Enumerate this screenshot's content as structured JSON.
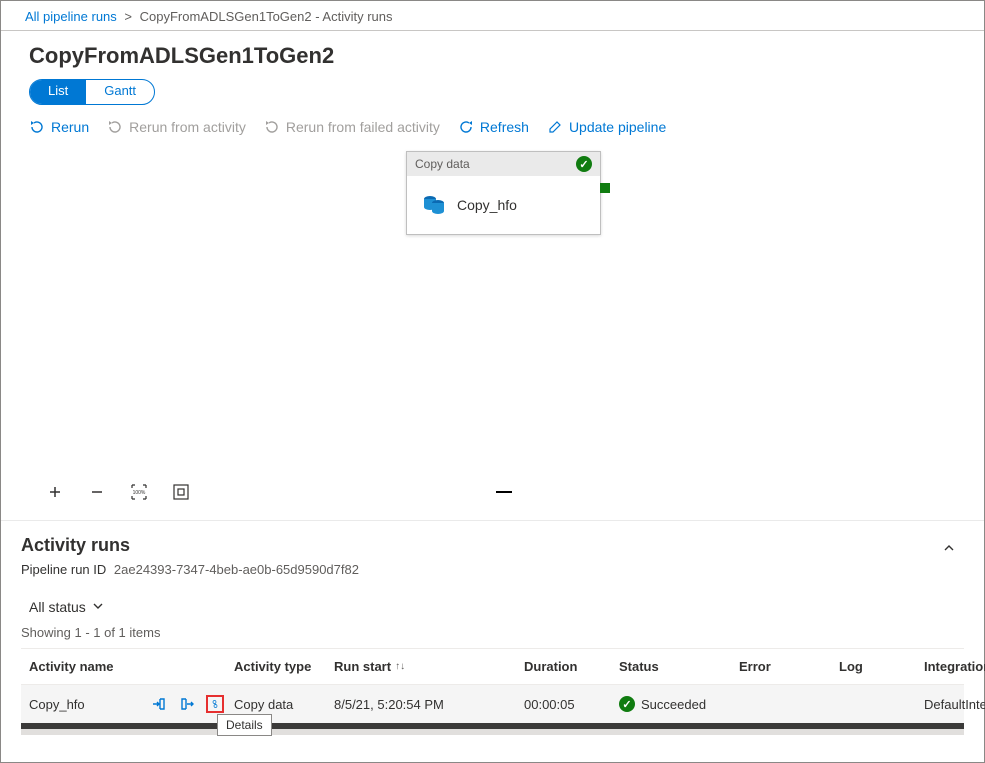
{
  "breadcrumb": {
    "root": "All pipeline runs",
    "current": "CopyFromADLSGen1ToGen2 - Activity runs"
  },
  "page_title": "CopyFromADLSGen1ToGen2",
  "view_toggle": {
    "list": "List",
    "gantt": "Gantt"
  },
  "toolbar": {
    "rerun": "Rerun",
    "rerun_from_activity": "Rerun from activity",
    "rerun_from_failed": "Rerun from failed activity",
    "refresh": "Refresh",
    "update_pipeline": "Update pipeline"
  },
  "node": {
    "type_label": "Copy data",
    "activity_name": "Copy_hfo"
  },
  "zoom": {
    "hundred": "100%"
  },
  "panel": {
    "title": "Activity runs",
    "run_id_label": "Pipeline run ID",
    "run_id_value": "2ae24393-7347-4beb-ae0b-65d9590d7f82",
    "filter_label": "All status",
    "count_text": "Showing 1 - 1 of 1 items"
  },
  "columns": {
    "activity_name": "Activity name",
    "activity_type": "Activity type",
    "run_start": "Run start",
    "duration": "Duration",
    "status": "Status",
    "error": "Error",
    "log": "Log",
    "integration": "Integration r"
  },
  "row": {
    "name": "Copy_hfo",
    "type": "Copy data",
    "run_start": "8/5/21, 5:20:54 PM",
    "duration": "00:00:05",
    "status": "Succeeded",
    "integration": "DefaultInteg"
  },
  "tooltip": {
    "details": "Details"
  }
}
